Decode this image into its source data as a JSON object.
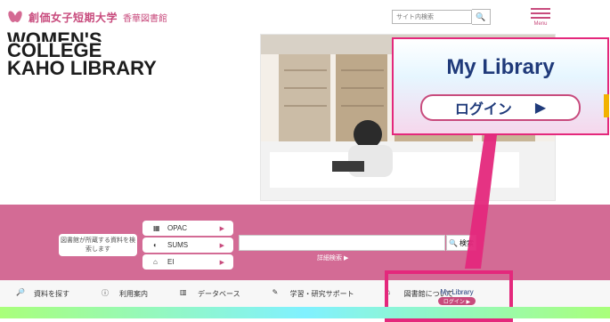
{
  "header": {
    "logo_text": "創価女子短期大学",
    "library_name": "香華図書館",
    "search_placeholder": "サイト内検索",
    "search_button": "🔍",
    "menu_label": "Menu"
  },
  "hero": {
    "title_line1": "WOMEN'S",
    "title_line2": "COLLEGE",
    "title_line3": "KAHO LIBRARY"
  },
  "popup": {
    "title": "My Library",
    "login_label": "ログイン",
    "arrow": "▶"
  },
  "search_panel": {
    "info_text": "図書館が所蔵する資料を検索します",
    "tabs": [
      {
        "label": "OPAC"
      },
      {
        "label": "SUMS"
      },
      {
        "label": "EI"
      }
    ],
    "search_button": "検索",
    "detail_link": "詳細検索 ▶"
  },
  "bottom_nav": {
    "items": [
      {
        "label": "資料を探す"
      },
      {
        "label": "利用案内"
      },
      {
        "label": "データベース"
      },
      {
        "label": "学習・研究サポート"
      },
      {
        "label": "図書館について"
      }
    ],
    "my_library": {
      "title": "My Library",
      "login": "ログイン ▶"
    }
  }
}
